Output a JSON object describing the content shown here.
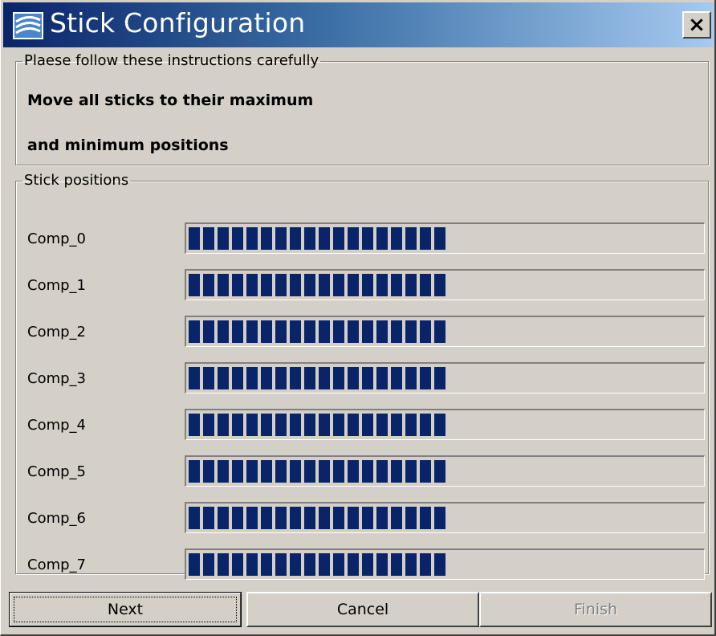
{
  "window": {
    "title": "Stick Configuration",
    "close_label": "×",
    "title_icon": "app-logo-icon"
  },
  "instructions": {
    "legend": "Plaese follow these instructions carefully",
    "line1": "Move all sticks to their maximum",
    "line2": "and minimum positions"
  },
  "stick_positions": {
    "legend": "Stick positions",
    "fill_color": "#0a246a",
    "items": [
      {
        "label": "Comp_0",
        "level": 0.5
      },
      {
        "label": "Comp_1",
        "level": 0.5
      },
      {
        "label": "Comp_2",
        "level": 0.5
      },
      {
        "label": "Comp_3",
        "level": 0.5
      },
      {
        "label": "Comp_4",
        "level": 0.5
      },
      {
        "label": "Comp_5",
        "level": 0.5
      },
      {
        "label": "Comp_6",
        "level": 0.5
      },
      {
        "label": "Comp_7",
        "level": 0.5
      }
    ]
  },
  "buttons": {
    "next": "Next",
    "cancel": "Cancel",
    "finish": "Finish"
  }
}
